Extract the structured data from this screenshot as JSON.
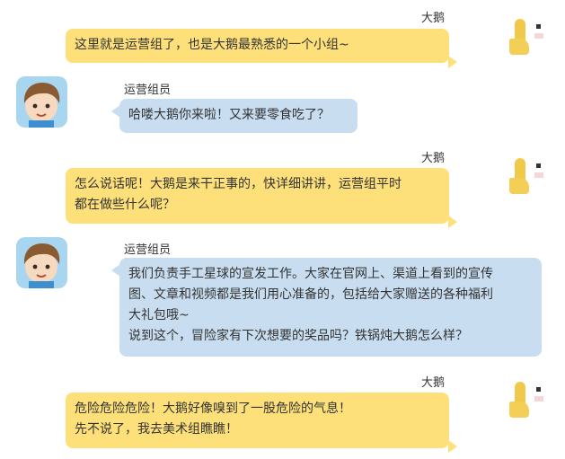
{
  "messages": [
    {
      "side": "right",
      "sender": "大鹅",
      "lines": [
        "这里就是运营组了，也是大鹅最熟悉的一个小组~"
      ]
    },
    {
      "side": "left",
      "sender": "运营组员",
      "lines": [
        "哈喽大鹅你来啦！又来要零食吃了？"
      ]
    },
    {
      "side": "right",
      "sender": "大鹅",
      "lines": [
        "怎么说话呢！大鹅是来干正事的，快详细讲讲，运营组平时",
        "都在做些什么呢？"
      ]
    },
    {
      "side": "left",
      "sender": "运营组员",
      "lines": [
        "我们负责手工星球的宣发工作。大家在官网上、渠道上看到的宣传",
        "图、文章和视频都是我们用心准备的，包括给大家赠送的各种福利",
        "大礼包哦~",
        "说到这个，冒险家有下次想要的奖品吗？铁锅炖大鹅怎么样？"
      ]
    },
    {
      "side": "right",
      "sender": "大鹅",
      "lines": [
        "危险危险危险！大鹅好像嗅到了一股危险的气息！",
        "先不说了，我去美术组瞧瞧！"
      ]
    }
  ],
  "icons": {
    "right_avatar": "goose-avatar-icon",
    "left_avatar": "staff-avatar-icon"
  },
  "colors": {
    "right_bubble": "#fde07a",
    "left_bubble": "#c8def0",
    "avatar_bg": "#a8d6f0"
  }
}
